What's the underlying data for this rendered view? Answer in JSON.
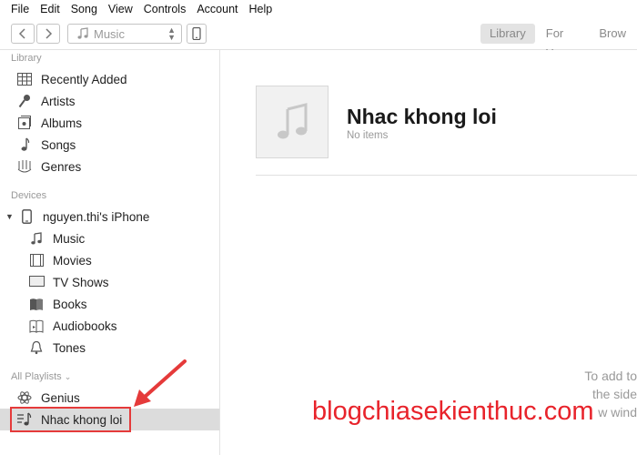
{
  "menu": [
    "File",
    "Edit",
    "Song",
    "View",
    "Controls",
    "Account",
    "Help"
  ],
  "toolbar": {
    "media_selector": "Music",
    "tabs": [
      "Library",
      "For You",
      "Brow"
    ]
  },
  "sidebar": {
    "library_header": "Library",
    "library_items": [
      "Recently Added",
      "Artists",
      "Albums",
      "Songs",
      "Genres"
    ],
    "devices_header": "Devices",
    "device_name": "nguyen.thi's iPhone",
    "device_items": [
      "Music",
      "Movies",
      "TV Shows",
      "Books",
      "Audiobooks",
      "Tones"
    ],
    "playlists_header": "All Playlists",
    "playlist_items": [
      "Genius",
      "Nhac khong loi"
    ]
  },
  "main": {
    "playlist_title": "Nhac khong loi",
    "playlist_subtitle": "No items",
    "hint_lines": [
      "To add to",
      "the side",
      "w wind"
    ]
  },
  "watermark": "blogchiasekienthuc.com",
  "colors": {
    "annotation": "#e53a3a",
    "selected_bg": "#dcdcdc"
  }
}
